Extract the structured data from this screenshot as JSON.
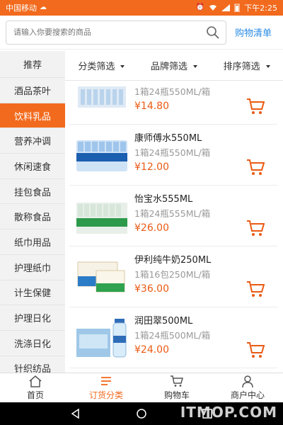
{
  "status_bar": {
    "carrier": "中国移动",
    "time": "下午2:25"
  },
  "search": {
    "placeholder": "请输入你要搜索的商品",
    "cart_list_label": "购物清单"
  },
  "sidebar": {
    "items": [
      {
        "label": "推荐"
      },
      {
        "label": "酒品茶叶"
      },
      {
        "label": "饮料乳品"
      },
      {
        "label": "营养冲调"
      },
      {
        "label": "休闲速食"
      },
      {
        "label": "挂包食品"
      },
      {
        "label": "散称食品"
      },
      {
        "label": "纸巾用品"
      },
      {
        "label": "护理纸巾"
      },
      {
        "label": "计生保健"
      },
      {
        "label": "护理日化"
      },
      {
        "label": "洗涤日化"
      },
      {
        "label": "针织纺品"
      }
    ],
    "active_label": "饮料乳品"
  },
  "filters": [
    {
      "label": "分类筛选"
    },
    {
      "label": "品牌筛选"
    },
    {
      "label": "排序筛选"
    }
  ],
  "products": [
    {
      "name": "",
      "spec": "1箱24瓶550ML/箱",
      "price": "¥14.80"
    },
    {
      "name": "康师傅水550ML",
      "spec": "1箱24瓶550ML/箱",
      "price": "¥12.00"
    },
    {
      "name": "怡宝水555ML",
      "spec": "1箱24瓶555ML/箱",
      "price": "¥26.00"
    },
    {
      "name": "伊利纯牛奶250ML",
      "spec": "1箱16包250ML/箱",
      "price": "¥36.00"
    },
    {
      "name": "润田翠500ML",
      "spec": "1箱24瓶500ML/箱",
      "price": "¥24.00"
    }
  ],
  "bottom_nav": [
    {
      "label": "首页",
      "icon": "home-icon"
    },
    {
      "label": "订货分类",
      "icon": "category-icon"
    },
    {
      "label": "购物车",
      "icon": "cart-icon"
    },
    {
      "label": "商户中心",
      "icon": "user-icon"
    }
  ],
  "watermark": "ITMOP.COM",
  "colors": {
    "accent": "#f26a1d",
    "price": "#ea5a13",
    "link": "#2b8ce5"
  }
}
